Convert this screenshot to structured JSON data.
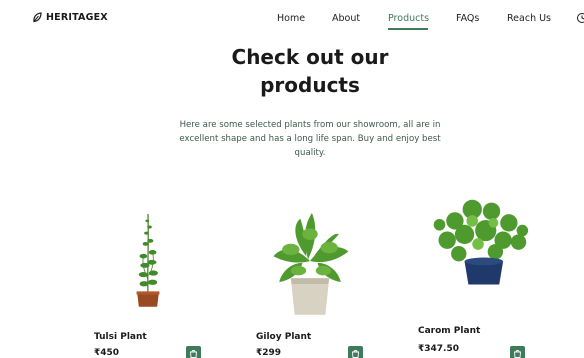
{
  "brand": {
    "name": "HERITAGEX",
    "accent": "#3f7a5a"
  },
  "nav": {
    "items": [
      "Home",
      "About",
      "Products",
      "FAQs",
      "Reach Us"
    ],
    "active": "Products"
  },
  "hero": {
    "title": "Check out our products",
    "subtitle": "Here are some selected plants from our showroom, all are in excellent shape and has a long life span. Buy and enjoy best quality."
  },
  "products": [
    {
      "name": "Tulsi Plant",
      "price": "₹450",
      "icon": "shopping-bag-icon"
    },
    {
      "name": "Giloy Plant",
      "price": "₹299",
      "icon": "shopping-bag-icon"
    },
    {
      "name": "Carom Plant",
      "price": "₹347.50",
      "icon": "shopping-bag-icon"
    }
  ]
}
